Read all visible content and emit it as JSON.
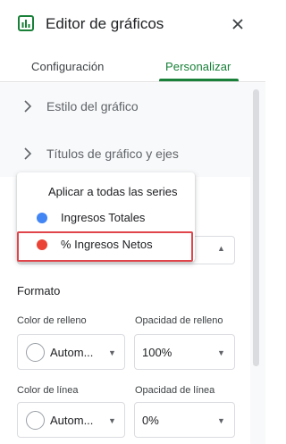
{
  "header": {
    "title": "Editor de gráficos",
    "icon": "bar-chart-icon",
    "accent": "#188038"
  },
  "tabs": [
    {
      "label": "Configuración",
      "active": false
    },
    {
      "label": "Personalizar",
      "active": true
    }
  ],
  "sections": [
    {
      "label": "Estilo del gráfico"
    },
    {
      "label": "Títulos de gráfico y ejes"
    }
  ],
  "series_menu": {
    "items": [
      {
        "label": "Aplicar a todas las series"
      },
      {
        "label": "Ingresos Totales",
        "color": "#4285f4"
      },
      {
        "label": "% Ingresos Netos",
        "color": "#ea4335",
        "highlighted": true
      }
    ]
  },
  "format": {
    "heading": "Formato",
    "fill_color": {
      "label": "Color de relleno",
      "value": "Autom..."
    },
    "fill_opacity": {
      "label": "Opacidad de relleno",
      "value": "100%"
    },
    "line_color": {
      "label": "Color de línea",
      "value": "Autom..."
    },
    "line_opacity": {
      "label": "Opacidad de línea",
      "value": "0%"
    }
  }
}
